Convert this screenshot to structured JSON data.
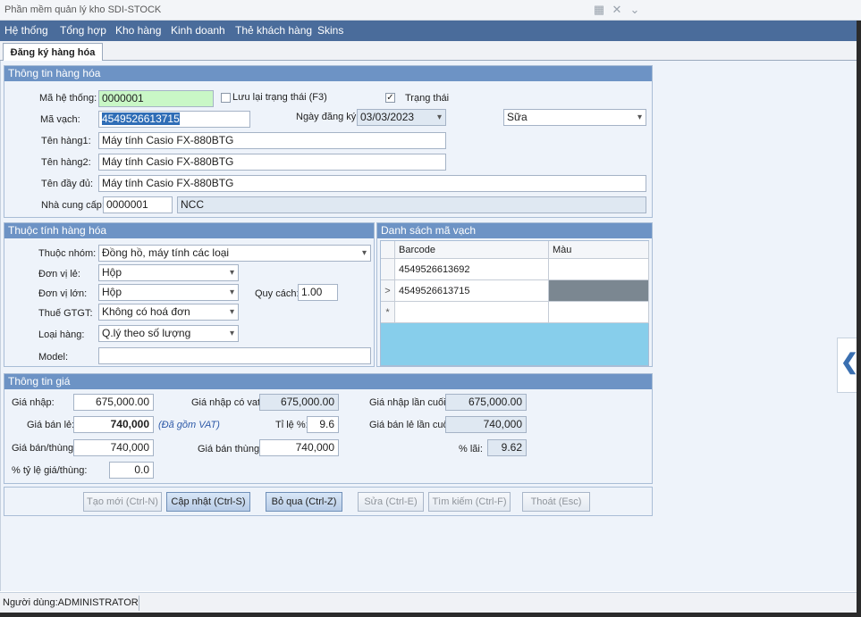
{
  "window": {
    "title": "Phần mềm quản lý kho SDI-STOCK",
    "icons": [
      "grid-icon",
      "collapse-icon",
      "chevron-down-icon"
    ]
  },
  "menu": [
    "Hệ thống",
    "Tổng hợp",
    "Kho hàng",
    "Kinh doanh",
    "Thẻ khách hàng",
    "Skins"
  ],
  "tab": {
    "label": "Đăng ký hàng hóa"
  },
  "info_panel": {
    "title": "Thông tin hàng hóa",
    "ma_he_thong_label": "Mã hệ thống:",
    "ma_he_thong_value": "0000001",
    "luu_lai_label": "Lưu lại trạng thái (F3)",
    "trang_thai_label": "Trạng thái",
    "trang_thai_checked": true,
    "ma_vach_label": "Mã vạch:",
    "ma_vach_value": "4549526613715",
    "ngay_dang_ky_label": "Ngày đăng ký:",
    "ngay_dang_ky_value": "03/03/2023",
    "status_select": "Sữa",
    "ten_hang1_label": "Tên hàng1:",
    "ten_hang1_value": "Máy tính Casio FX-880BTG",
    "ten_hang2_label": "Tên hàng2:",
    "ten_hang2_value": "Máy tính Casio FX-880BTG",
    "ten_day_du_label": "Tên đầy đủ:",
    "ten_day_du_value": "Máy tính Casio FX-880BTG",
    "nha_cung_cap_label": "Nhà cung cấp:",
    "nha_cung_cap_code": "0000001",
    "nha_cung_cap_name": "NCC"
  },
  "attr_panel": {
    "title": "Thuộc tính hàng hóa",
    "thuoc_nhom_label": "Thuộc nhóm:",
    "thuoc_nhom_value": "Đồng hồ, máy tính các loại",
    "don_vi_le_label": "Đơn vị lẻ:",
    "don_vi_le_value": "Hộp",
    "don_vi_lon_label": "Đơn vị lớn:",
    "don_vi_lon_value": "Hộp",
    "quy_cach_label": "Quy cách:",
    "quy_cach_value": "1.00",
    "thue_label": "Thuế GTGT:",
    "thue_value": "Không có hoá đơn",
    "loai_hang_label": "Loại hàng:",
    "loai_hang_value": "Q.lý theo số lượng",
    "model_label": "Model:",
    "model_value": ""
  },
  "barcode_panel": {
    "title": "Danh sách mã vạch",
    "columns": [
      "Barcode",
      "Màu"
    ],
    "rows": [
      {
        "indicator": "",
        "barcode": "4549526613692",
        "mau": ""
      },
      {
        "indicator": ">",
        "barcode": "4549526613715",
        "mau": ""
      },
      {
        "indicator": "*",
        "barcode": "",
        "mau": ""
      }
    ],
    "selected_color": "#7b8791"
  },
  "price_panel": {
    "title": "Thông tin giá",
    "gia_nhap_label": "Giá nhập:",
    "gia_nhap_value": "675,000.00",
    "gia_nhap_vat_label": "Giá nhập có vat:",
    "gia_nhap_vat_value": "675,000.00",
    "gia_nhap_cuoi_label": "Giá nhập lần cuối:",
    "gia_nhap_cuoi_value": "675,000.00",
    "gia_ban_le_label": "Giá bán lẻ:",
    "gia_ban_le_value": "740,000",
    "vat_note": "(Đã gồm VAT)",
    "ti_le_label": "Tỉ lệ %:",
    "ti_le_value": "9.6",
    "gia_ban_le_cuoi_label": "Giá bán lẻ lần cuối:",
    "gia_ban_le_cuoi_value": "740,000",
    "gia_ban_thung_label": "Giá bán/thùng:",
    "gia_ban_thung_value": "740,000",
    "gia_ban_thung2_label": "Giá bán thùng:",
    "gia_ban_thung2_value": "740,000",
    "lai_label": "% lãi:",
    "lai_value": "9.62",
    "ty_le_thung_label": "% tỷ lệ giá/thùng:",
    "ty_le_thung_value": "0.0"
  },
  "buttons": {
    "tao_moi": "Tạo mới (Ctrl-N)",
    "cap_nhat": "Cập nhật (Ctrl-S)",
    "bo_qua": "Bỏ qua (Ctrl-Z)",
    "sua": "Sửa (Ctrl-E)",
    "tim_kiem": "Tìm kiếm (Ctrl-F)",
    "thoat": "Thoát (Esc)"
  },
  "status": {
    "user": "Người dùng:ADMINISTRATOR"
  },
  "colors": {
    "menubar": "#4a6c9b",
    "panel_header": "#6d93c5",
    "grid_bg": "#87ceeb",
    "highlight_green": "#c9f7c6"
  }
}
